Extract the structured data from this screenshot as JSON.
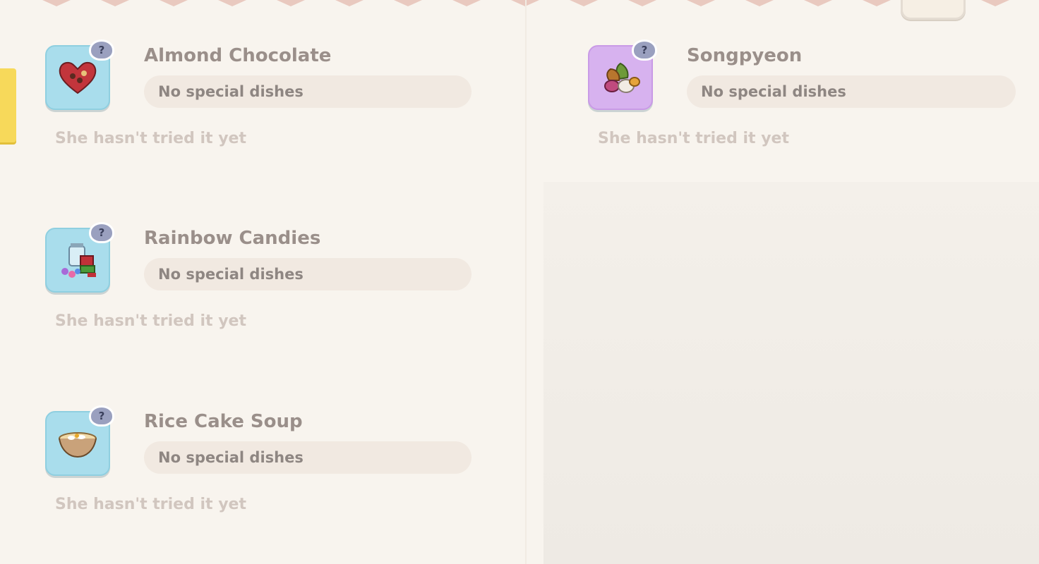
{
  "colors": {
    "background": "#f8f4ee",
    "zigzag": "#e9c9bf",
    "side_tab": "#f7d95a",
    "icon_blue": "#a9ddec",
    "icon_purple": "#d7b2ef"
  },
  "dishes": [
    {
      "name": "Almond Chocolate",
      "status": "No special dishes",
      "tried": "She hasn't tried it yet",
      "badge": "?",
      "icon": "heart-chocolate-box-icon"
    },
    {
      "name": "Songpyeon",
      "status": "No special dishes",
      "tried": "She hasn't tried it yet",
      "badge": "?",
      "icon": "songpyeon-icon"
    },
    {
      "name": "Rainbow Candies",
      "status": "No special dishes",
      "tried": "She hasn't tried it yet",
      "badge": "?",
      "icon": "candy-jar-icon"
    },
    {
      "name": "Rice Cake Soup",
      "status": "No special dishes",
      "tried": "She hasn't tried it yet",
      "badge": "?",
      "icon": "soup-bowl-icon"
    }
  ]
}
